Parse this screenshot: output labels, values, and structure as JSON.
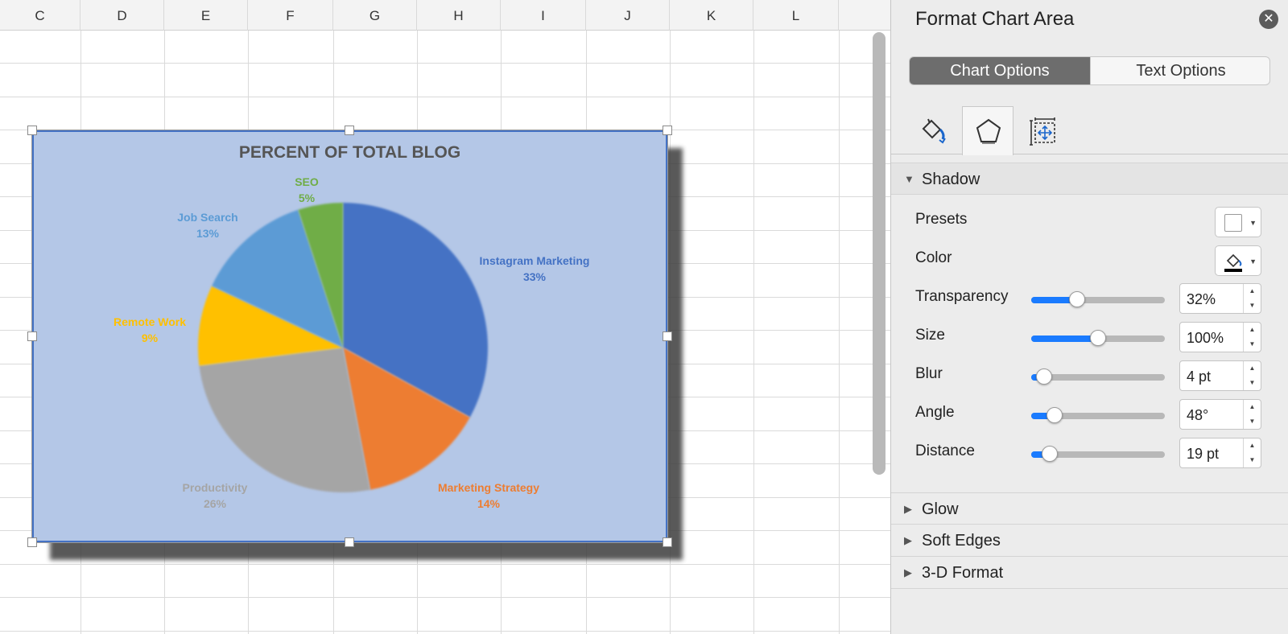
{
  "sheet": {
    "columns": [
      "C",
      "D",
      "E",
      "F",
      "G",
      "H",
      "I",
      "J",
      "K",
      "L"
    ]
  },
  "chart_data": {
    "type": "pie",
    "title": "PERCENT OF TOTAL BLOG",
    "categories": [
      "Instagram Marketing",
      "Marketing Strategy",
      "Productivity",
      "Remote Work",
      "Job Search",
      "SEO"
    ],
    "values": [
      33,
      14,
      26,
      9,
      13,
      5
    ],
    "labels": [
      "33%",
      "14%",
      "26%",
      "9%",
      "13%",
      "5%"
    ],
    "colors": [
      "#4472c4",
      "#ed7d31",
      "#a5a5a5",
      "#ffc000",
      "#5b9bd5",
      "#70ad47"
    ],
    "background": "#b4c7e7",
    "legend": "none"
  },
  "pane": {
    "title": "Format Chart Area",
    "close_icon": "close-icon",
    "tabs": [
      "Chart Options",
      "Text Options"
    ],
    "icon_tabs": [
      "fill-line-icon",
      "effects-icon",
      "size-properties-icon"
    ],
    "sections": {
      "shadow": "Shadow",
      "glow": "Glow",
      "soft_edges": "Soft Edges",
      "format_3d": "3-D Format"
    },
    "shadow": {
      "presets_label": "Presets",
      "color_label": "Color",
      "color_value": "#000000",
      "transparency": {
        "label": "Transparency",
        "value": "32%",
        "level": 0.32
      },
      "size": {
        "label": "Size",
        "value": "100%",
        "level": 0.5
      },
      "blur": {
        "label": "Blur",
        "value": "4 pt",
        "level": 0.04
      },
      "angle": {
        "label": "Angle",
        "value": "48°",
        "level": 0.13
      },
      "distance": {
        "label": "Distance",
        "value": "19 pt",
        "level": 0.09
      }
    }
  }
}
